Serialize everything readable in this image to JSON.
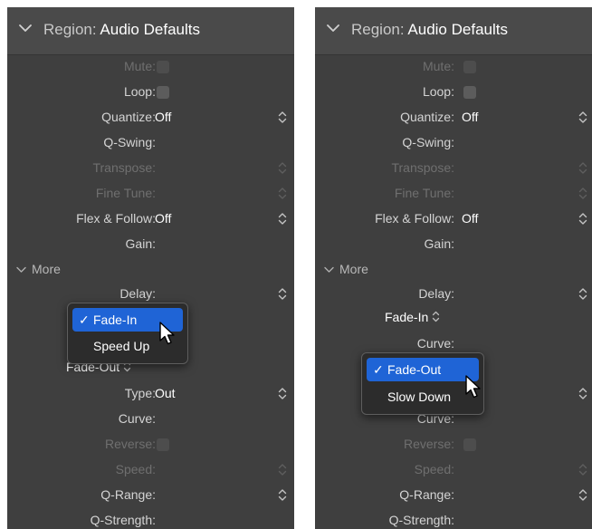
{
  "left": {
    "header": {
      "prefix": "Region:",
      "name": "Audio Defaults"
    },
    "rows": {
      "mute": {
        "label": "Mute:"
      },
      "loop": {
        "label": "Loop:"
      },
      "quantize": {
        "label": "Quantize:",
        "value": "Off"
      },
      "qswing": {
        "label": "Q-Swing:"
      },
      "transpose": {
        "label": "Transpose:"
      },
      "finetune": {
        "label": "Fine Tune:"
      },
      "flex": {
        "label": "Flex & Follow:",
        "value": "Off"
      },
      "gain": {
        "label": "Gain:"
      },
      "delay": {
        "label": "Delay:"
      },
      "type": {
        "label": "Type:",
        "value": "Out"
      },
      "curve": {
        "label": "Curve:"
      },
      "reverse": {
        "label": "Reverse:"
      },
      "speed": {
        "label": "Speed:"
      },
      "qrange": {
        "label": "Q-Range:"
      },
      "qstrength": {
        "label": "Q-Strength:"
      }
    },
    "more_label": "More",
    "fadeout_popup": "Fade-Out",
    "menu": {
      "items": [
        "Fade-In",
        "Speed Up"
      ],
      "checked": "✓"
    }
  },
  "right": {
    "header": {
      "prefix": "Region:",
      "name": "Audio Defaults"
    },
    "rows": {
      "mute": {
        "label": "Mute:"
      },
      "loop": {
        "label": "Loop:"
      },
      "quantize": {
        "label": "Quantize:",
        "value": "Off"
      },
      "qswing": {
        "label": "Q-Swing:"
      },
      "transpose": {
        "label": "Transpose:"
      },
      "finetune": {
        "label": "Fine Tune:"
      },
      "flex": {
        "label": "Flex & Follow:",
        "value": "Off"
      },
      "gain": {
        "label": "Gain:"
      },
      "delay": {
        "label": "Delay:"
      },
      "curve": {
        "label": "Curve:"
      },
      "curve2": {
        "label": "Curve:"
      },
      "reverse": {
        "label": "Reverse:"
      },
      "speed": {
        "label": "Speed:"
      },
      "qrange": {
        "label": "Q-Range:"
      },
      "qstrength": {
        "label": "Q-Strength:"
      }
    },
    "more_label": "More",
    "fadein_popup": "Fade-In",
    "menu": {
      "items": [
        "Fade-Out",
        "Slow Down"
      ],
      "checked": "✓"
    }
  },
  "colors": {
    "panel": "#3f3f3f",
    "header": "#4a4a4a",
    "menu_highlight": "#1f64d6",
    "dim_text": "#6f6f6f"
  },
  "icons": [
    "chevron-down-icon",
    "stepper-icon",
    "checkbox",
    "checkmark-icon",
    "mouse-pointer-icon"
  ]
}
